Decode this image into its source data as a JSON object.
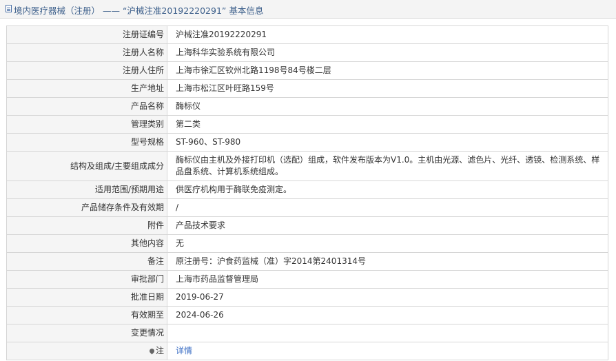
{
  "header": {
    "title": "境内医疗器械（注册） —— “沪械注准20192220291” 基本信息"
  },
  "rows": [
    {
      "label": "注册证编号",
      "value": "沪械注准20192220291"
    },
    {
      "label": "注册人名称",
      "value": "上海科华实验系统有限公司"
    },
    {
      "label": "注册人住所",
      "value": "上海市徐汇区钦州北路1198号84号楼二层"
    },
    {
      "label": "生产地址",
      "value": "上海市松江区叶旺路159号"
    },
    {
      "label": "产品名称",
      "value": "酶标仪"
    },
    {
      "label": "管理类别",
      "value": "第二类"
    },
    {
      "label": "型号规格",
      "value": "ST-960、ST-980"
    },
    {
      "label": "结构及组成/主要组成成分",
      "value": "酶标仪由主机及外接打印机（选配）组成，软件发布版本为V1.0。主机由光源、滤色片、光纤、透镜、检测系统、样品盘系统、计算机系统组成。"
    },
    {
      "label": "适用范围/预期用途",
      "value": "供医疗机构用于酶联免疫测定。"
    },
    {
      "label": "产品储存条件及有效期",
      "value": "/"
    },
    {
      "label": "附件",
      "value": "产品技术要求"
    },
    {
      "label": "其他内容",
      "value": "无"
    },
    {
      "label": "备注",
      "value": "原注册号：沪食药监械（准）字2014第2401314号"
    },
    {
      "label": "审批部门",
      "value": "上海市药品监督管理局"
    },
    {
      "label": "批准日期",
      "value": "2019-06-27"
    },
    {
      "label": "有效期至",
      "value": "2024-06-26"
    },
    {
      "label": "变更情况",
      "value": ""
    }
  ],
  "note_row": {
    "label": "注",
    "link": "详情"
  }
}
